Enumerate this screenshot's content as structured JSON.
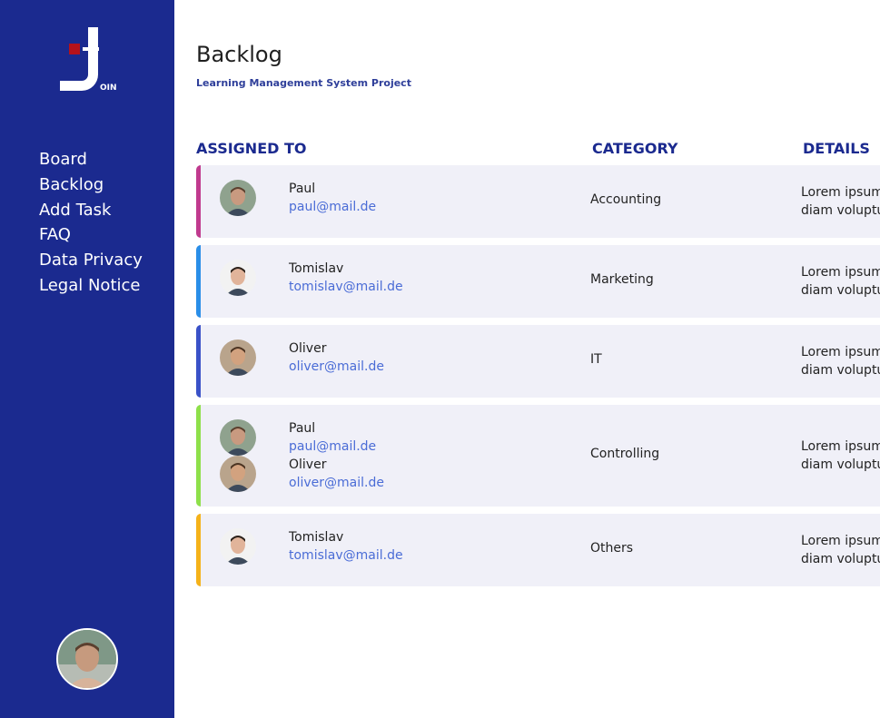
{
  "nav": {
    "items": [
      "Board",
      "Backlog",
      "Add Task",
      "FAQ",
      "Data Privacy",
      "Legal Notice"
    ]
  },
  "logo": {
    "letter": "J",
    "text": "OIN"
  },
  "header": {
    "title": "Backlog",
    "subtitle": "Learning Management System Project"
  },
  "columns": {
    "assigned": "ASSIGNED TO",
    "category": "CATEGORY",
    "details": "DETAILS"
  },
  "tasks": [
    {
      "color": "#c03a8e",
      "category": "Accounting",
      "details_line1": "Lorem ipsum",
      "details_line2": "diam voluptu",
      "people": [
        {
          "name": "Paul",
          "email": "paul@mail.de"
        }
      ]
    },
    {
      "color": "#2a8ee8",
      "category": "Marketing",
      "details_line1": "Lorem ipsum",
      "details_line2": "diam voluptu",
      "people": [
        {
          "name": "Tomislav",
          "email": "tomislav@mail.de"
        }
      ]
    },
    {
      "color": "#3a52c8",
      "category": "IT",
      "details_line1": "Lorem ipsum",
      "details_line2": "diam voluptu",
      "people": [
        {
          "name": "Oliver",
          "email": "oliver@mail.de"
        }
      ]
    },
    {
      "color": "#8ee04a",
      "category": "Controlling",
      "details_line1": "Lorem ipsum",
      "details_line2": "diam voluptu",
      "people": [
        {
          "name": "Paul",
          "email": "paul@mail.de"
        },
        {
          "name": "Oliver",
          "email": "oliver@mail.de"
        }
      ]
    },
    {
      "color": "#f5b21a",
      "category": "Others",
      "details_line1": "Lorem ipsum",
      "details_line2": "diam voluptu",
      "people": [
        {
          "name": "Tomislav",
          "email": "tomislav@mail.de"
        }
      ]
    }
  ],
  "colors": {
    "sidebar": "#1b2a8f",
    "accent_red": "#b5121b",
    "row_bg": "#f0f0f8",
    "link": "#4a6cd6"
  }
}
